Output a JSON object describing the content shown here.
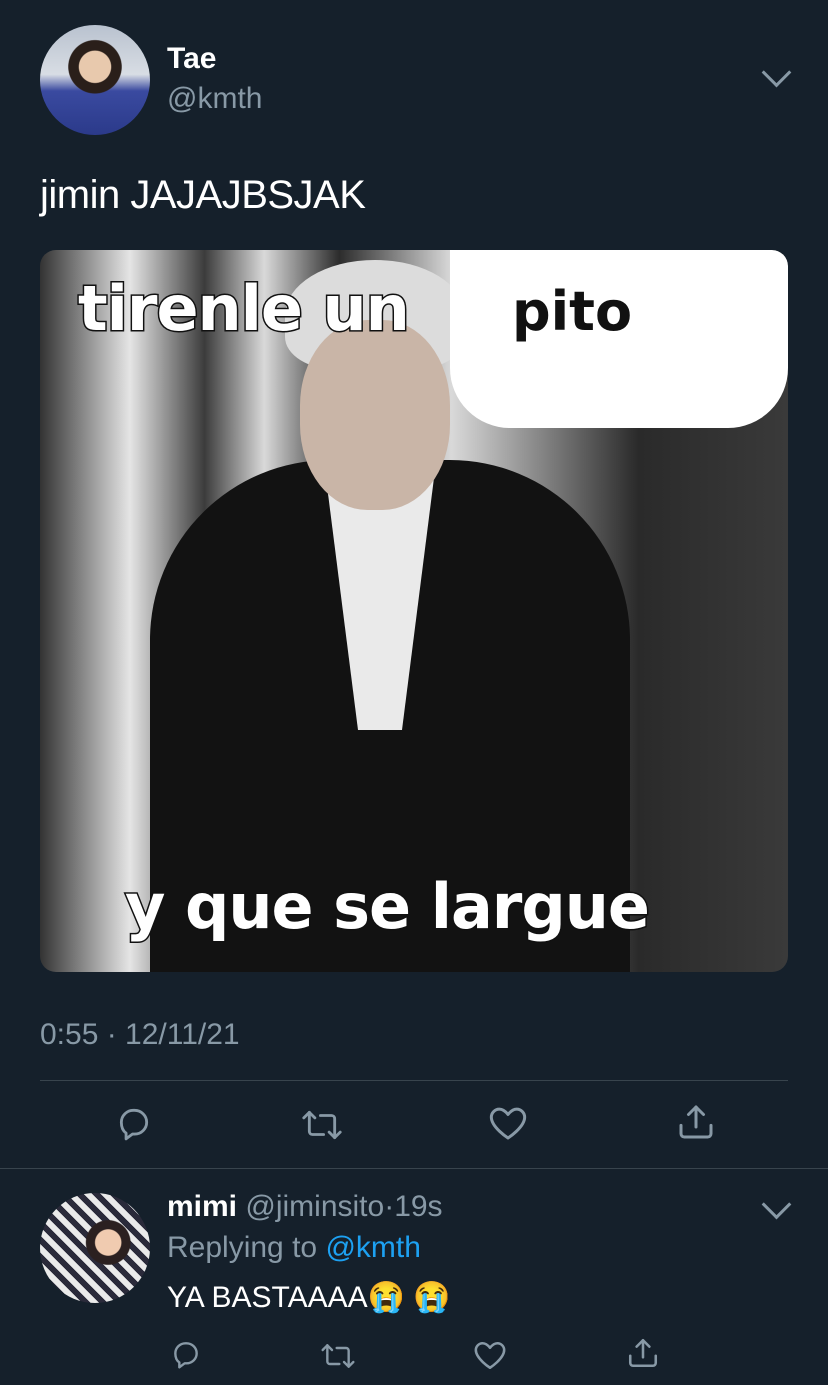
{
  "tweet": {
    "author_name": "Tae",
    "author_handle": "@kmth",
    "text": "jimin JAJAJBSJAK",
    "media": {
      "top_text": "tirenle un",
      "bubble_text": "pito",
      "bottom_text": "y que se largue"
    },
    "timestamp": "0:55 · 12/11/21"
  },
  "reply": {
    "author_name": "mimi",
    "author_handle": "@jiminsito",
    "separator": "·",
    "time": "19s",
    "replying_prefix": "Replying to",
    "replying_to": "@kmth",
    "text": "YA BASTAAAA😭 😭"
  },
  "icons": {
    "reply": "reply-icon",
    "retweet": "retweet-icon",
    "like": "heart-icon",
    "share": "share-icon",
    "more": "chevron-down-icon"
  },
  "colors": {
    "background": "#15202b",
    "secondary_text": "#8899a6",
    "link": "#1da1f2",
    "divider": "#38444d"
  }
}
